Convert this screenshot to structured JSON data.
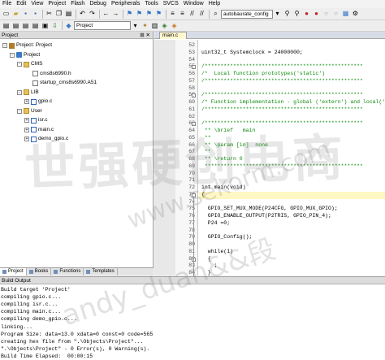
{
  "menubar": [
    "File",
    "Edit",
    "View",
    "Project",
    "Flash",
    "Debug",
    "Peripherals",
    "Tools",
    "SVCS",
    "Window",
    "Help"
  ],
  "toolbar": {
    "target_combo": "autobaurate_config",
    "project_combo": "Project"
  },
  "project_panel": {
    "title": "Project",
    "tree": [
      {
        "label": "Project: Project",
        "level": 0,
        "kind": "proj",
        "expander": "-"
      },
      {
        "label": "Project",
        "level": 1,
        "kind": "target",
        "expander": "-"
      },
      {
        "label": "CMS",
        "level": 2,
        "kind": "folder",
        "expander": "-"
      },
      {
        "label": "cms8s6990.h",
        "level": 3,
        "kind": "file",
        "expander": ""
      },
      {
        "label": "startup_cms8s6990.A51",
        "level": 3,
        "kind": "file",
        "expander": ""
      },
      {
        "label": "LIB",
        "level": 2,
        "kind": "folder",
        "expander": "-"
      },
      {
        "label": "gpio.c",
        "level": 3,
        "kind": "file-c",
        "expander": "+"
      },
      {
        "label": "User",
        "level": 2,
        "kind": "folder",
        "expander": "-"
      },
      {
        "label": "isr.c",
        "level": 3,
        "kind": "file-c",
        "expander": "+"
      },
      {
        "label": "main.c",
        "level": 3,
        "kind": "file-c",
        "expander": "+"
      },
      {
        "label": "demo_gpio.c",
        "level": 3,
        "kind": "file-c",
        "expander": "+"
      }
    ],
    "tabs": [
      "Project",
      "Books",
      "Functions",
      "Templates"
    ]
  },
  "editor": {
    "tab_label": "main.c",
    "lines": [
      {
        "num": "52",
        "text": "",
        "cls": ""
      },
      {
        "num": "53",
        "text": "uint32_t Systemclock = 24000000;",
        "cls": ""
      },
      {
        "num": "54",
        "text": "",
        "cls": ""
      },
      {
        "num": "55",
        "text": "/**************************************************",
        "cls": "cmt"
      },
      {
        "num": "56",
        "text": "/*  Local function prototypes('static')",
        "cls": "cmt"
      },
      {
        "num": "57",
        "text": "/**************************************************",
        "cls": "cmt"
      },
      {
        "num": "58",
        "text": "",
        "cls": ""
      },
      {
        "num": "59",
        "text": "/**************************************************",
        "cls": "cmt"
      },
      {
        "num": "60",
        "text": "/* Function implementation - global ('extern') and local('sta",
        "cls": "cmt"
      },
      {
        "num": "61",
        "text": "/**************************************************",
        "cls": "cmt"
      },
      {
        "num": "62",
        "text": "",
        "cls": ""
      },
      {
        "num": "63",
        "text": "/**************************************************",
        "cls": "cmt"
      },
      {
        "num": "64",
        "text": " ** \\brief   main",
        "cls": "cmt"
      },
      {
        "num": "65",
        "text": " **",
        "cls": "cmt"
      },
      {
        "num": "66",
        "text": " ** \\param [in]  none",
        "cls": "cmt"
      },
      {
        "num": "67",
        "text": " **",
        "cls": "cmt"
      },
      {
        "num": "68",
        "text": " ** \\return 0",
        "cls": "cmt"
      },
      {
        "num": "69",
        "text": " **************************************************",
        "cls": "cmt"
      },
      {
        "num": "70",
        "text": "",
        "cls": ""
      },
      {
        "num": "71",
        "text": "",
        "cls": ""
      },
      {
        "num": "72",
        "text": "int main(void)",
        "cls": ""
      },
      {
        "num": "73",
        "text": "{",
        "cls": ""
      },
      {
        "num": "74",
        "text": "",
        "cls": ""
      },
      {
        "num": "75",
        "text": "  GPIO_SET_MUX_MODE(P24CFG, GPIO_MUX_GPIO);",
        "cls": ""
      },
      {
        "num": "76",
        "text": "  GPIO_ENABLE_OUTPUT(P2TRIS, GPIO_PIN_4);",
        "cls": ""
      },
      {
        "num": "77",
        "text": "  P24 =0;",
        "cls": ""
      },
      {
        "num": "78",
        "text": "",
        "cls": ""
      },
      {
        "num": "79",
        "text": "  GPIO_Config();",
        "cls": ""
      },
      {
        "num": "80",
        "text": "",
        "cls": ""
      },
      {
        "num": "81",
        "text": "  while(1)",
        "cls": ""
      },
      {
        "num": "82",
        "text": "  {",
        "cls": ""
      },
      {
        "num": "83",
        "text": "    ;",
        "cls": ""
      },
      {
        "num": "84",
        "text": "  }",
        "cls": ""
      },
      {
        "num": "85",
        "text": "}",
        "cls": ""
      }
    ]
  },
  "build_output": {
    "title": "Build Output",
    "lines": [
      "Build target 'Project'",
      "compiling gpio.c...",
      "compiling isr.c...",
      "compiling main.c...",
      "compiling demo_gpio.c...",
      "linking...",
      "Program Size: data=13.0 xdata=0 const=0 code=565",
      "creating hex file from \".\\Objects\\Project\"...",
      "\".\\Objects\\Project\" - 0 Error(s), 0 Warning(s).",
      "Build Time Elapsed:  00:00:15"
    ]
  },
  "watermark": {
    "big": "世强硬创电商",
    "url": "www.sekorm.com",
    "user": "andy_duan&&段"
  },
  "colors": {
    "comment": "#0a8a0a",
    "highlight_line": "#fff7c4",
    "tab_active": "#fff7cf"
  }
}
